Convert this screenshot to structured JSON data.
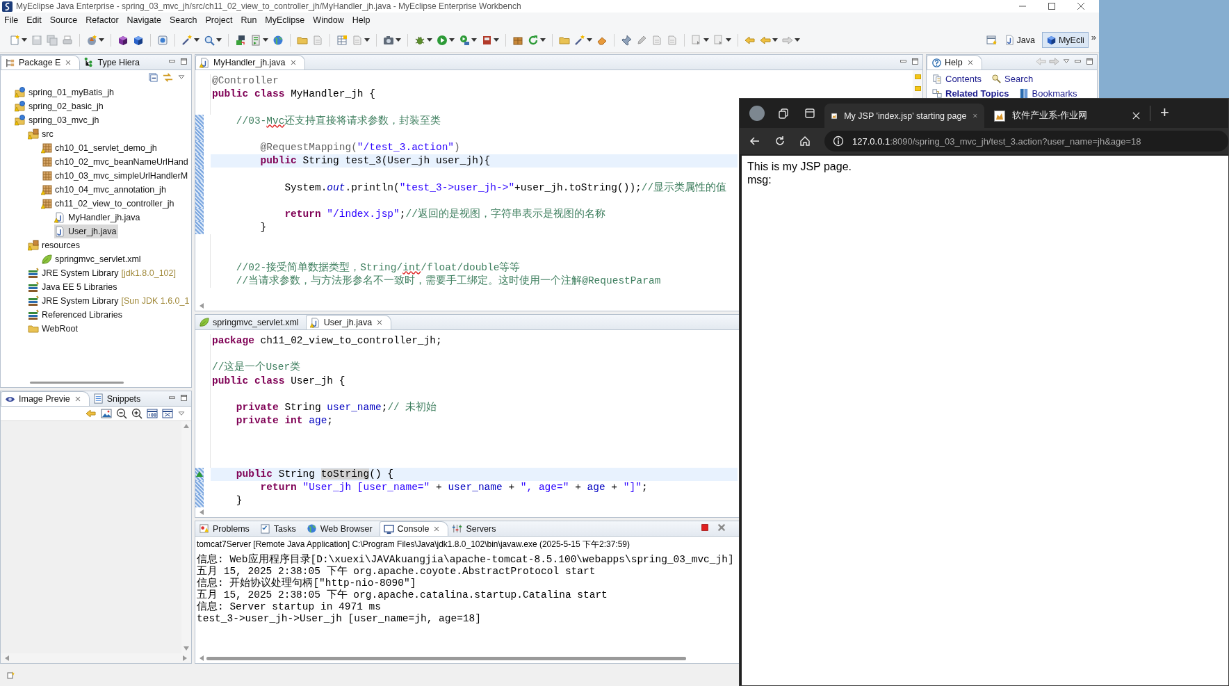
{
  "window": {
    "title": "MyEclipse Java Enterprise - spring_03_mvc_jh/src/ch11_02_view_to_controller_jh/MyHandler_jh.java - MyEclipse Enterprise Workbench"
  },
  "menu": [
    "File",
    "Edit",
    "Source",
    "Refactor",
    "Navigate",
    "Search",
    "Project",
    "Run",
    "MyEclipse",
    "Window",
    "Help"
  ],
  "toolbar": [
    {
      "kind": "new",
      "dropdown": true
    },
    {
      "kind": "save",
      "dropdown": false
    },
    {
      "kind": "saveall",
      "dropdown": false
    },
    {
      "kind": "print",
      "dropdown": false
    },
    {
      "kind": "separator"
    },
    {
      "kind": "newjava",
      "dropdown": true
    },
    {
      "kind": "separator"
    },
    {
      "kind": "cube",
      "dropdown": false
    },
    {
      "kind": "cubeblue",
      "dropdown": false
    },
    {
      "kind": "separator"
    },
    {
      "kind": "web",
      "dropdown": false
    },
    {
      "kind": "separator"
    },
    {
      "kind": "wand",
      "dropdown": true
    },
    {
      "kind": "search",
      "dropdown": true
    },
    {
      "kind": "separator"
    },
    {
      "kind": "deploy",
      "dropdown": false
    },
    {
      "kind": "server",
      "dropdown": true
    },
    {
      "kind": "globe",
      "dropdown": false
    },
    {
      "kind": "separator"
    },
    {
      "kind": "folder",
      "dropdown": false
    },
    {
      "kind": "page",
      "dropdown": false
    },
    {
      "kind": "separator"
    },
    {
      "kind": "table",
      "dropdown": false
    },
    {
      "kind": "page",
      "dropdown": true
    },
    {
      "kind": "separator"
    },
    {
      "kind": "camera",
      "dropdown": true
    },
    {
      "kind": "separator"
    },
    {
      "kind": "bug",
      "dropdown": true
    },
    {
      "kind": "run",
      "dropdown": true
    },
    {
      "kind": "runcfg",
      "dropdown": true
    },
    {
      "kind": "stop",
      "dropdown": true
    },
    {
      "kind": "separator"
    },
    {
      "kind": "box",
      "dropdown": false
    },
    {
      "kind": "refresh",
      "dropdown": true
    },
    {
      "kind": "separator"
    },
    {
      "kind": "folder",
      "dropdown": false
    },
    {
      "kind": "wand",
      "dropdown": true
    },
    {
      "kind": "eraser",
      "dropdown": false
    },
    {
      "kind": "separator"
    },
    {
      "kind": "pin",
      "dropdown": false
    },
    {
      "kind": "pencil",
      "dropdown": false
    },
    {
      "kind": "page",
      "dropdown": false
    },
    {
      "kind": "page",
      "dropdown": false
    },
    {
      "kind": "separator"
    },
    {
      "kind": "down",
      "dropdown": true
    },
    {
      "kind": "up",
      "dropdown": true
    },
    {
      "kind": "separator"
    },
    {
      "kind": "backedit",
      "dropdown": false
    },
    {
      "kind": "back",
      "dropdown": true
    },
    {
      "kind": "forward",
      "dropdown": true
    }
  ],
  "perspectives": [
    {
      "label": "Java",
      "selected": false
    },
    {
      "label": "MyEcli",
      "selected": true
    }
  ],
  "perspective_more": "»",
  "package_explorer": {
    "tabs": [
      {
        "label": "Package E",
        "kind": "explorer",
        "selected": true
      },
      {
        "label": "Type Hiera",
        "kind": "hierarchy",
        "selected": false
      }
    ],
    "tree": [
      {
        "label": "spring_01_myBatis_jh",
        "kind": "project",
        "selected": false
      },
      {
        "label": "spring_02_basic_jh",
        "kind": "project",
        "selected": false
      },
      {
        "label": "spring_03_mvc_jh",
        "kind": "project",
        "selected": false,
        "children": [
          {
            "label": "src",
            "kind": "srcfolder",
            "selected": false,
            "children": [
              {
                "label": "ch10_01_servlet_demo_jh",
                "kind": "package",
                "selected": false
              },
              {
                "label": "ch10_02_mvc_beanNameUrlHand",
                "kind": "package",
                "selected": false
              },
              {
                "label": "ch10_03_mvc_simpleUrlHandlerM",
                "kind": "package",
                "selected": false
              },
              {
                "label": "ch10_04_mvc_annotation_jh",
                "kind": "package",
                "selected": false
              },
              {
                "label": "ch11_02_view_to_controller_jh",
                "kind": "package",
                "selected": false,
                "children": [
                  {
                    "label": "MyHandler_jh.java",
                    "kind": "java",
                    "selected": false
                  },
                  {
                    "label": "User_jh.java",
                    "kind": "java",
                    "selected": true
                  }
                ]
              }
            ]
          },
          {
            "label": "resources",
            "kind": "srcfolder",
            "selected": false,
            "children": [
              {
                "label": "springmvc_servlet.xml",
                "kind": "xml",
                "selected": false
              }
            ]
          },
          {
            "label": "JRE System Library",
            "decoration": "[jdk1.8.0_102]",
            "kind": "library",
            "selected": false
          },
          {
            "label": "Java EE 5 Libraries",
            "kind": "library",
            "selected": false
          },
          {
            "label": "JRE System Library",
            "decoration": "[Sun JDK 1.6.0_1",
            "kind": "library",
            "selected": false
          },
          {
            "label": "Referenced Libraries",
            "kind": "library",
            "selected": false
          },
          {
            "label": "WebRoot",
            "kind": "folder",
            "selected": false
          }
        ]
      }
    ]
  },
  "image_preview": {
    "tabs": [
      {
        "label": "Image Previe",
        "kind": "eye",
        "selected": true
      },
      {
        "label": "Snippets",
        "kind": "snippets",
        "selected": false
      }
    ],
    "tools": [
      {
        "kind": "backedit"
      },
      {
        "kind": "picture"
      },
      {
        "kind": "zoomout"
      },
      {
        "kind": "zoomin"
      },
      {
        "kind": "actual"
      },
      {
        "kind": "fit"
      }
    ]
  },
  "editors": [
    {
      "tabs": [
        {
          "label": "MyHandler_jh.java",
          "kind": "java",
          "selected": true
        }
      ],
      "lines": [
        {
          "kind": "code",
          "current": false,
          "in_range": false,
          "override_marker": false,
          "tokens": [
            {
              "kind": "annotation",
              "text": "@Controller"
            }
          ]
        },
        {
          "kind": "code",
          "current": false,
          "in_range": false,
          "override_marker": false,
          "tokens": [
            {
              "kind": "keyword",
              "text": "public"
            },
            {
              "kind": "keyword",
              "text": " class"
            },
            {
              "kind": "plain",
              "text": " MyHandler_jh {"
            }
          ]
        },
        {
          "kind": "blank",
          "current": false,
          "in_range": false,
          "override_marker": false
        },
        {
          "kind": "code",
          "current": false,
          "in_range": true,
          "override_marker": false,
          "tokens": [
            {
              "kind": "comment",
              "text": "    //03-"
            },
            {
              "kind": "typo",
              "text": "Mvc"
            },
            {
              "kind": "comment",
              "text": "还支持直接将请求参数，封装至类"
            }
          ]
        },
        {
          "kind": "blank",
          "current": false,
          "in_range": true,
          "override_marker": false
        },
        {
          "kind": "code",
          "current": false,
          "in_range": true,
          "override_marker": false,
          "tokens": [
            {
              "kind": "annotation",
              "text": "        @RequestMapping("
            },
            {
              "kind": "string",
              "text": "\"/test_3.action\""
            },
            {
              "kind": "annotation",
              "text": ")"
            }
          ]
        },
        {
          "kind": "code",
          "current": true,
          "in_range": true,
          "override_marker": false,
          "tokens": [
            {
              "kind": "keyword",
              "text": "        public"
            },
            {
              "kind": "plain",
              "text": " String test_3(User_jh user_jh){"
            }
          ]
        },
        {
          "kind": "blank",
          "current": false,
          "in_range": true,
          "override_marker": false
        },
        {
          "kind": "code",
          "current": false,
          "in_range": true,
          "override_marker": false,
          "tokens": [
            {
              "kind": "plain",
              "text": "            System."
            },
            {
              "kind": "static",
              "text": "out"
            },
            {
              "kind": "plain",
              "text": ".println("
            },
            {
              "kind": "string",
              "text": "\"test_3->user_jh->\""
            },
            {
              "kind": "plain",
              "text": "+user_jh.toString());"
            },
            {
              "kind": "comment",
              "text": "//显示类属性的值"
            }
          ]
        },
        {
          "kind": "blank",
          "current": false,
          "in_range": true,
          "override_marker": false
        },
        {
          "kind": "code",
          "current": false,
          "in_range": true,
          "override_marker": false,
          "tokens": [
            {
              "kind": "keyword",
              "text": "            return"
            },
            {
              "kind": "string",
              "text": " \"/index.jsp\""
            },
            {
              "kind": "plain",
              "text": ";"
            },
            {
              "kind": "comment",
              "text": "//返回的是视图，字符串表示是视图的名称"
            }
          ]
        },
        {
          "kind": "code",
          "current": false,
          "in_range": true,
          "override_marker": false,
          "tokens": [
            {
              "kind": "plain",
              "text": "        }"
            }
          ]
        },
        {
          "kind": "blank",
          "current": false,
          "in_range": false,
          "override_marker": false
        },
        {
          "kind": "blank",
          "current": false,
          "in_range": false,
          "override_marker": false
        },
        {
          "kind": "code",
          "current": false,
          "in_range": false,
          "override_marker": false,
          "tokens": [
            {
              "kind": "comment",
              "text": "    //02-接受简单数据类型，String/"
            },
            {
              "kind": "typo",
              "text": "int"
            },
            {
              "kind": "comment",
              "text": "/float/double等等"
            }
          ]
        },
        {
          "kind": "code",
          "current": false,
          "in_range": false,
          "override_marker": false,
          "tokens": [
            {
              "kind": "comment",
              "text": "    //当请求参数，与方法形参名不一致时，需要手工绑定。这时使用一个注解@RequestParam"
            }
          ]
        }
      ]
    },
    {
      "tabs": [
        {
          "label": "springmvc_servlet.xml",
          "kind": "xml",
          "selected": false
        },
        {
          "label": "User_jh.java",
          "kind": "java",
          "selected": true
        }
      ],
      "lines": [
        {
          "kind": "code",
          "current": false,
          "in_range": false,
          "override_marker": false,
          "tokens": [
            {
              "kind": "keyword",
              "text": "package"
            },
            {
              "kind": "plain",
              "text": " ch11_02_view_to_controller_jh;"
            }
          ]
        },
        {
          "kind": "blank",
          "current": false,
          "in_range": false,
          "override_marker": false
        },
        {
          "kind": "code",
          "current": false,
          "in_range": false,
          "override_marker": false,
          "tokens": [
            {
              "kind": "comment",
              "text": "//这是一个User类"
            }
          ]
        },
        {
          "kind": "code",
          "current": false,
          "in_range": false,
          "override_marker": false,
          "tokens": [
            {
              "kind": "keyword",
              "text": "public"
            },
            {
              "kind": "keyword",
              "text": " class"
            },
            {
              "kind": "plain",
              "text": " User_jh {"
            }
          ]
        },
        {
          "kind": "blank",
          "current": false,
          "in_range": false,
          "override_marker": false
        },
        {
          "kind": "code",
          "current": false,
          "in_range": false,
          "override_marker": false,
          "tokens": [
            {
              "kind": "keyword",
              "text": "    private"
            },
            {
              "kind": "plain",
              "text": " String "
            },
            {
              "kind": "field",
              "text": "user_name"
            },
            {
              "kind": "plain",
              "text": ";"
            },
            {
              "kind": "comment",
              "text": "// 未初始"
            }
          ]
        },
        {
          "kind": "code",
          "current": false,
          "in_range": false,
          "override_marker": false,
          "tokens": [
            {
              "kind": "keyword",
              "text": "    private"
            },
            {
              "kind": "keyword",
              "text": " int"
            },
            {
              "kind": "field",
              "text": " age"
            },
            {
              "kind": "plain",
              "text": ";"
            }
          ]
        },
        {
          "kind": "blank",
          "current": false,
          "in_range": false,
          "override_marker": false
        },
        {
          "kind": "blank",
          "current": false,
          "in_range": false,
          "override_marker": false
        },
        {
          "kind": "blank",
          "current": false,
          "in_range": false,
          "override_marker": false
        },
        {
          "kind": "code",
          "current": true,
          "in_range": true,
          "override_marker": true,
          "tokens": [
            {
              "kind": "keyword",
              "text": "    public"
            },
            {
              "kind": "plain",
              "text": " String "
            },
            {
              "kind": "occurrence",
              "text": "toString"
            },
            {
              "kind": "plain",
              "text": "() {"
            }
          ]
        },
        {
          "kind": "code",
          "current": false,
          "in_range": true,
          "override_marker": false,
          "tokens": [
            {
              "kind": "keyword",
              "text": "        return"
            },
            {
              "kind": "string",
              "text": " \"User_jh [user_name=\""
            },
            {
              "kind": "plain",
              "text": " + "
            },
            {
              "kind": "field",
              "text": "user_name"
            },
            {
              "kind": "plain",
              "text": " + "
            },
            {
              "kind": "string",
              "text": "\", age=\""
            },
            {
              "kind": "plain",
              "text": " + "
            },
            {
              "kind": "field",
              "text": "age"
            },
            {
              "kind": "plain",
              "text": " + "
            },
            {
              "kind": "string",
              "text": "\"]\""
            },
            {
              "kind": "plain",
              "text": ";"
            }
          ]
        },
        {
          "kind": "code",
          "current": false,
          "in_range": true,
          "override_marker": false,
          "tokens": [
            {
              "kind": "plain",
              "text": "    }"
            }
          ]
        }
      ]
    }
  ],
  "console": {
    "tabs": [
      {
        "label": "Problems",
        "kind": "problems",
        "selected": false
      },
      {
        "label": "Tasks",
        "kind": "tasks",
        "selected": false
      },
      {
        "label": "Web Browser",
        "kind": "globe",
        "selected": false
      },
      {
        "label": "Console",
        "kind": "console",
        "selected": true
      },
      {
        "label": "Servers",
        "kind": "servers",
        "selected": false
      }
    ],
    "process": "tomcat7Server [Remote Java Application] C:\\Program Files\\Java\\jdk1.8.0_102\\bin\\javaw.exe (2025-5-15 下午2:37:59)",
    "lines": [
      "信息: Web应用程序目录[D:\\xuexi\\JAVAkuangjia\\apache-tomcat-8.5.100\\webapps\\spring_03_mvc_jh]",
      "五月 15, 2025 2:38:05 下午 org.apache.coyote.AbstractProtocol start",
      "信息: 开始协议处理句柄[\"http-nio-8090\"]",
      "五月 15, 2025 2:38:05 下午 org.apache.catalina.startup.Catalina start",
      "信息: Server startup in 4971 ms",
      "test_3->user_jh->User_jh [user_name=jh, age=18]"
    ]
  },
  "help": {
    "tabs": [
      {
        "label": "Help",
        "kind": "help",
        "selected": true
      }
    ],
    "links": [
      {
        "label": "Contents",
        "kind": "contents",
        "bold": false
      },
      {
        "label": "Search",
        "kind": "search",
        "bold": false
      },
      {
        "label": "Related Topics",
        "kind": "related",
        "bold": true
      },
      {
        "label": "Bookmarks",
        "kind": "bookmarks",
        "bold": false
      }
    ]
  },
  "browser": {
    "tabs": [
      {
        "title": "My JSP 'index.jsp' starting page",
        "selected": true
      },
      {
        "title": "软件产业系-作业网",
        "selected": false
      }
    ],
    "new_tab": "+",
    "url_host": "127.0.0.1",
    "url_rest": ":8090/spring_03_mvc_jh/test_3.action?user_name=jh&age=18",
    "content": [
      "This is my JSP page.",
      "msg:"
    ]
  }
}
